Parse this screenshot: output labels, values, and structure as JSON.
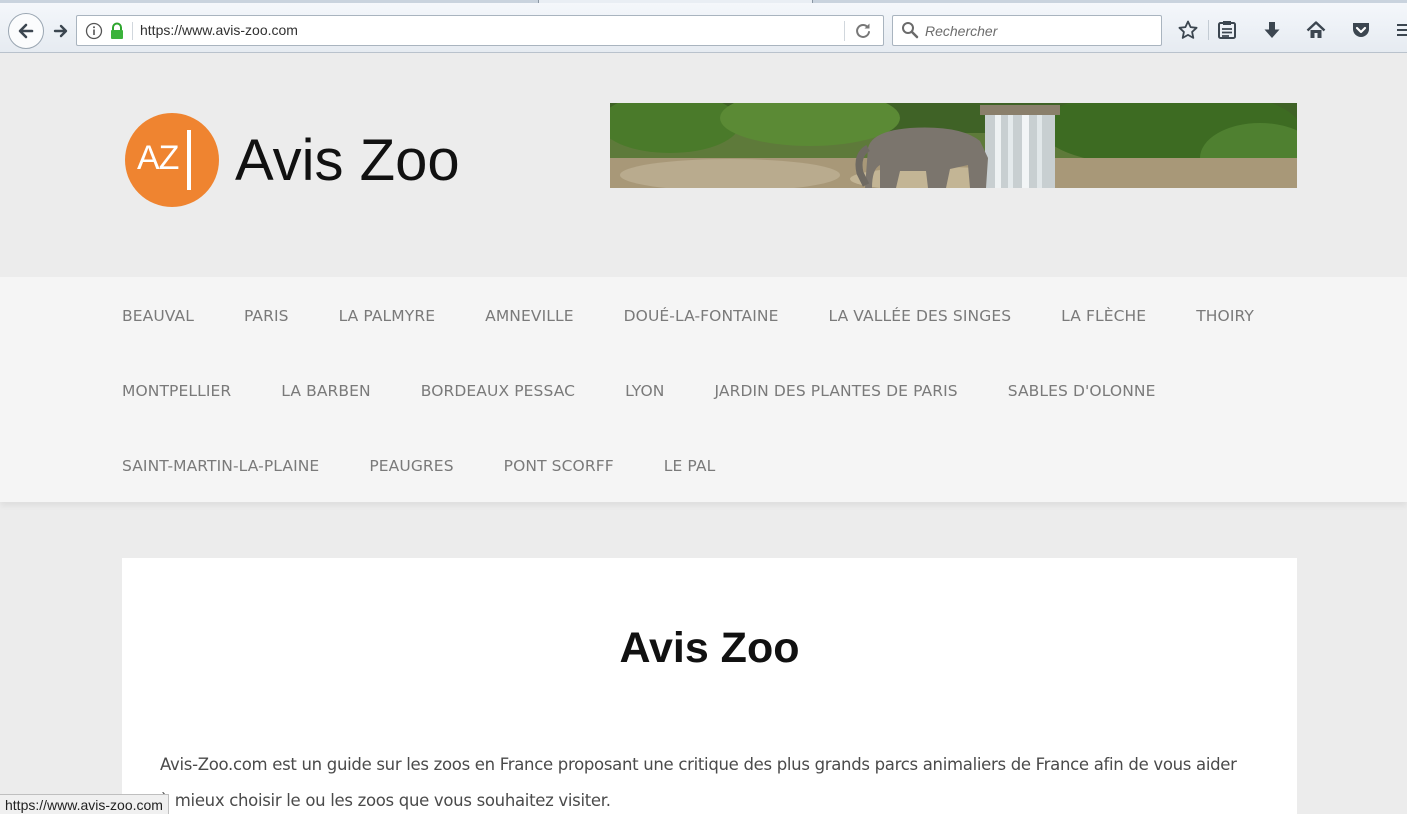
{
  "browser": {
    "url": "https://www.avis-zoo.com",
    "search_placeholder": "Rechercher",
    "status_text": "https://www.avis-zoo.com"
  },
  "header": {
    "logo_initials": "AZ",
    "logo_title": "Avis Zoo",
    "banner_image": "elephant-waterfall-photo"
  },
  "nav": {
    "row1": [
      "BEAUVAL",
      "PARIS",
      "LA PALMYRE",
      "AMNEVILLE",
      "DOUÉ-LA-FONTAINE",
      "LA VALLÉE DES SINGES",
      "LA FLÈCHE",
      "THOIRY"
    ],
    "row2": [
      "MONTPELLIER",
      "LA BARBEN",
      "BORDEAUX PESSAC",
      "LYON",
      "JARDIN DES PLANTES DE PARIS",
      "SABLES D'OLONNE"
    ],
    "row3": [
      "SAINT-MARTIN-LA-PLAINE",
      "PEAUGRES",
      "PONT SCORFF",
      "LE PAL"
    ]
  },
  "main": {
    "title": "Avis Zoo",
    "intro_line1": "Avis-Zoo.com est un guide sur les zoos en France proposant une critique des plus grands parcs animaliers de France afin de vous aider",
    "intro_line2": "à mieux choisir le ou les zoos que vous souhaitez visiter."
  },
  "colors": {
    "logo_orange": "#ef8430",
    "nav_text": "#7a7a7a",
    "page_bg": "#ececec"
  }
}
